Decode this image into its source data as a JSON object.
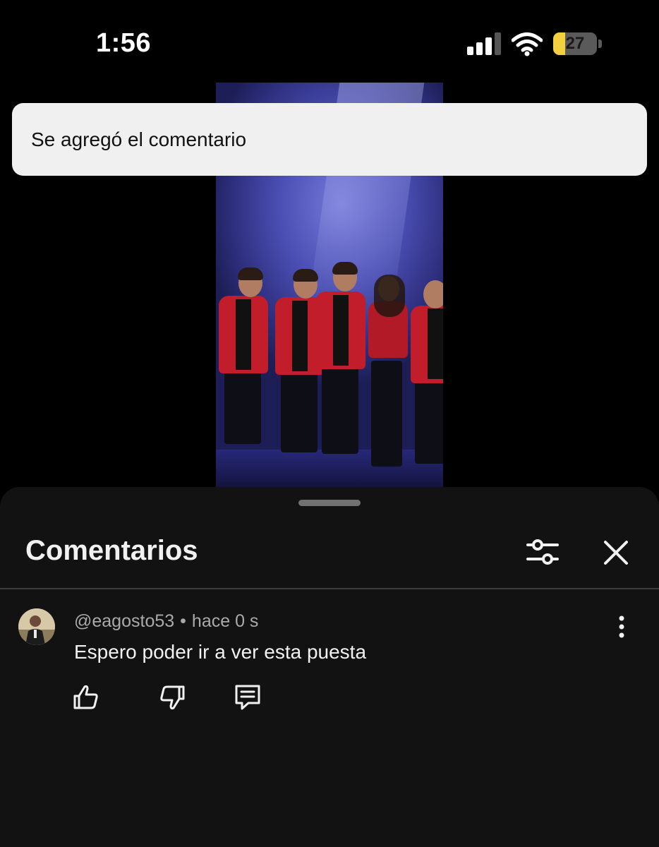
{
  "status_bar": {
    "time": "1:56",
    "battery_level": "27",
    "battery_fraction": 0.27,
    "battery_color": "#f4d03f",
    "signal_bars_active": 3,
    "icons": [
      "signal-icon",
      "wifi-icon",
      "battery-icon"
    ]
  },
  "video": {
    "content": "stage performance video"
  },
  "toast": {
    "message": "Se agregó el comentario"
  },
  "comments_sheet": {
    "title": "Comentarios",
    "filter_icon": "sliders-icon",
    "close_icon": "close-icon",
    "comments": [
      {
        "author": "@eagosto53",
        "separator": "•",
        "time": "hace 0 s",
        "text": "Espero poder ir a ver esta puesta",
        "actions": [
          "thumbs-up-icon",
          "thumbs-down-icon",
          "reply-icon"
        ],
        "menu_icon": "more-vertical-icon"
      }
    ]
  },
  "colors": {
    "background": "#000000",
    "sheet_background": "#121212",
    "toast_background": "#f0f0f0",
    "secondary_text": "#aaaaaa",
    "primary_text": "#f1f1f1"
  }
}
